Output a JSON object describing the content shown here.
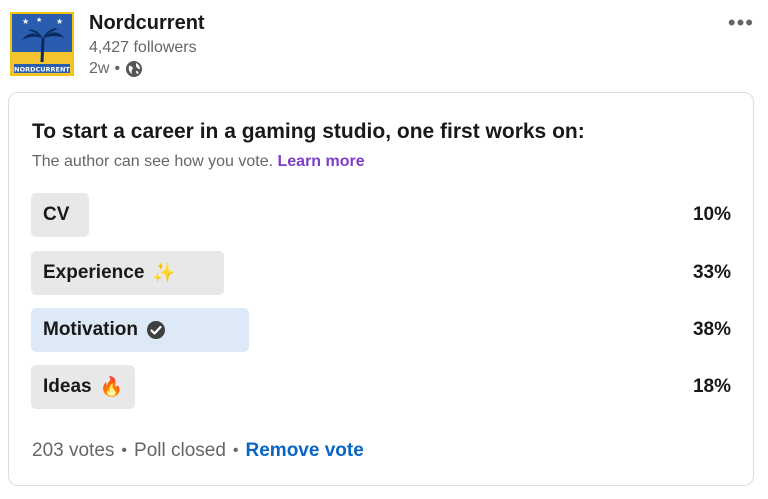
{
  "post": {
    "org_name": "Nordcurrent",
    "followers": "4,427 followers",
    "age": "2w",
    "separator": "•",
    "logo_text": "NORDCURRENT",
    "more_icon": "more-dots-icon",
    "visibility_icon": "globe-icon"
  },
  "poll": {
    "question": "To start a career in a gaming studio, one first works on:",
    "notice": "The author can see how you vote.",
    "learn_more": "Learn more",
    "options": [
      {
        "label": "CV",
        "percent": "10%",
        "fill": 0.1,
        "selected": false,
        "emoji": ""
      },
      {
        "label": "Experience",
        "percent": "33%",
        "fill": 0.33,
        "selected": false,
        "emoji": "✨"
      },
      {
        "label": "Motivation",
        "percent": "38%",
        "fill": 0.38,
        "selected": true,
        "emoji": ""
      },
      {
        "label": "Ideas",
        "percent": "18%",
        "fill": 0.18,
        "selected": false,
        "emoji": "🔥"
      }
    ],
    "votes": "203 votes",
    "status": "Poll closed",
    "remove_vote": "Remove vote",
    "dot": "•"
  },
  "colors": {
    "accent_link": "#0a66c2",
    "learn_more": "#7e3fc8",
    "selected_bar": "#dde9f7",
    "bar": "#e8e8e8"
  }
}
